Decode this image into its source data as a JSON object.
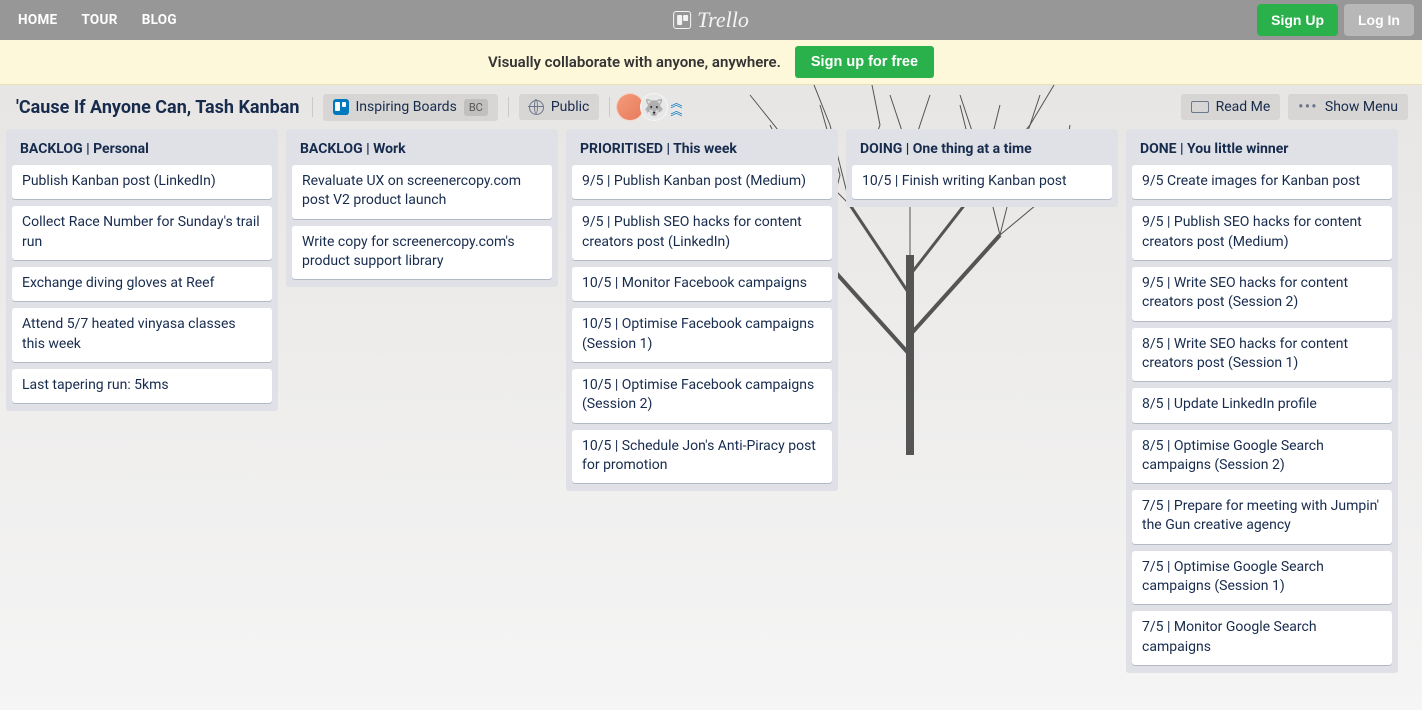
{
  "topnav": {
    "links": [
      "HOME",
      "TOUR",
      "BLOG"
    ],
    "brand": "Trello",
    "signup": "Sign Up",
    "login": "Log In"
  },
  "promo": {
    "text": "Visually collaborate with anyone, anywhere.",
    "cta": "Sign up for free"
  },
  "board": {
    "title": "'Cause If Anyone Can, Tash Kanban",
    "team_label": "Inspiring Boards",
    "team_badge": "BC",
    "visibility": "Public",
    "readme": "Read Me",
    "show_menu": "Show Menu"
  },
  "lists": [
    {
      "title": "BACKLOG | Personal",
      "cards": [
        "Publish Kanban post (LinkedIn)",
        "Collect Race Number for Sunday's trail run",
        "Exchange diving gloves at Reef",
        "Attend 5/7 heated vinyasa classes this week",
        "Last tapering run: 5kms"
      ]
    },
    {
      "title": "BACKLOG | Work",
      "cards": [
        "Revaluate UX on screenercopy.com post V2 product launch",
        "Write copy for screenercopy.com's product support library"
      ]
    },
    {
      "title": "PRIORITISED | This week",
      "cards": [
        "9/5 | Publish Kanban post (Medium)",
        "9/5 | Publish SEO hacks for content creators post (LinkedIn)",
        "10/5 | Monitor Facebook campaigns",
        "10/5 | Optimise Facebook campaigns (Session 1)",
        "10/5 | Optimise Facebook campaigns (Session 2)",
        "10/5 | Schedule Jon's Anti-Piracy post for promotion"
      ]
    },
    {
      "title": "DOING | One thing at a time",
      "cards": [
        "10/5 | Finish writing Kanban post"
      ]
    },
    {
      "title": "DONE | You little winner",
      "cards": [
        "9/5 Create images for Kanban post",
        "9/5 | Publish SEO hacks for content creators post (Medium)",
        "9/5 | Write SEO hacks for content creators post (Session 2)",
        "8/5 | Write SEO hacks for content creators post (Session 1)",
        "8/5 | Update LinkedIn profile",
        "8/5 | Optimise Google Search campaigns (Session 2)",
        "7/5 | Prepare for meeting with Jumpin' the Gun creative agency",
        "7/5 | Optimise Google Search campaigns (Session 1)",
        "7/5 | Monitor Google Search campaigns"
      ]
    }
  ]
}
